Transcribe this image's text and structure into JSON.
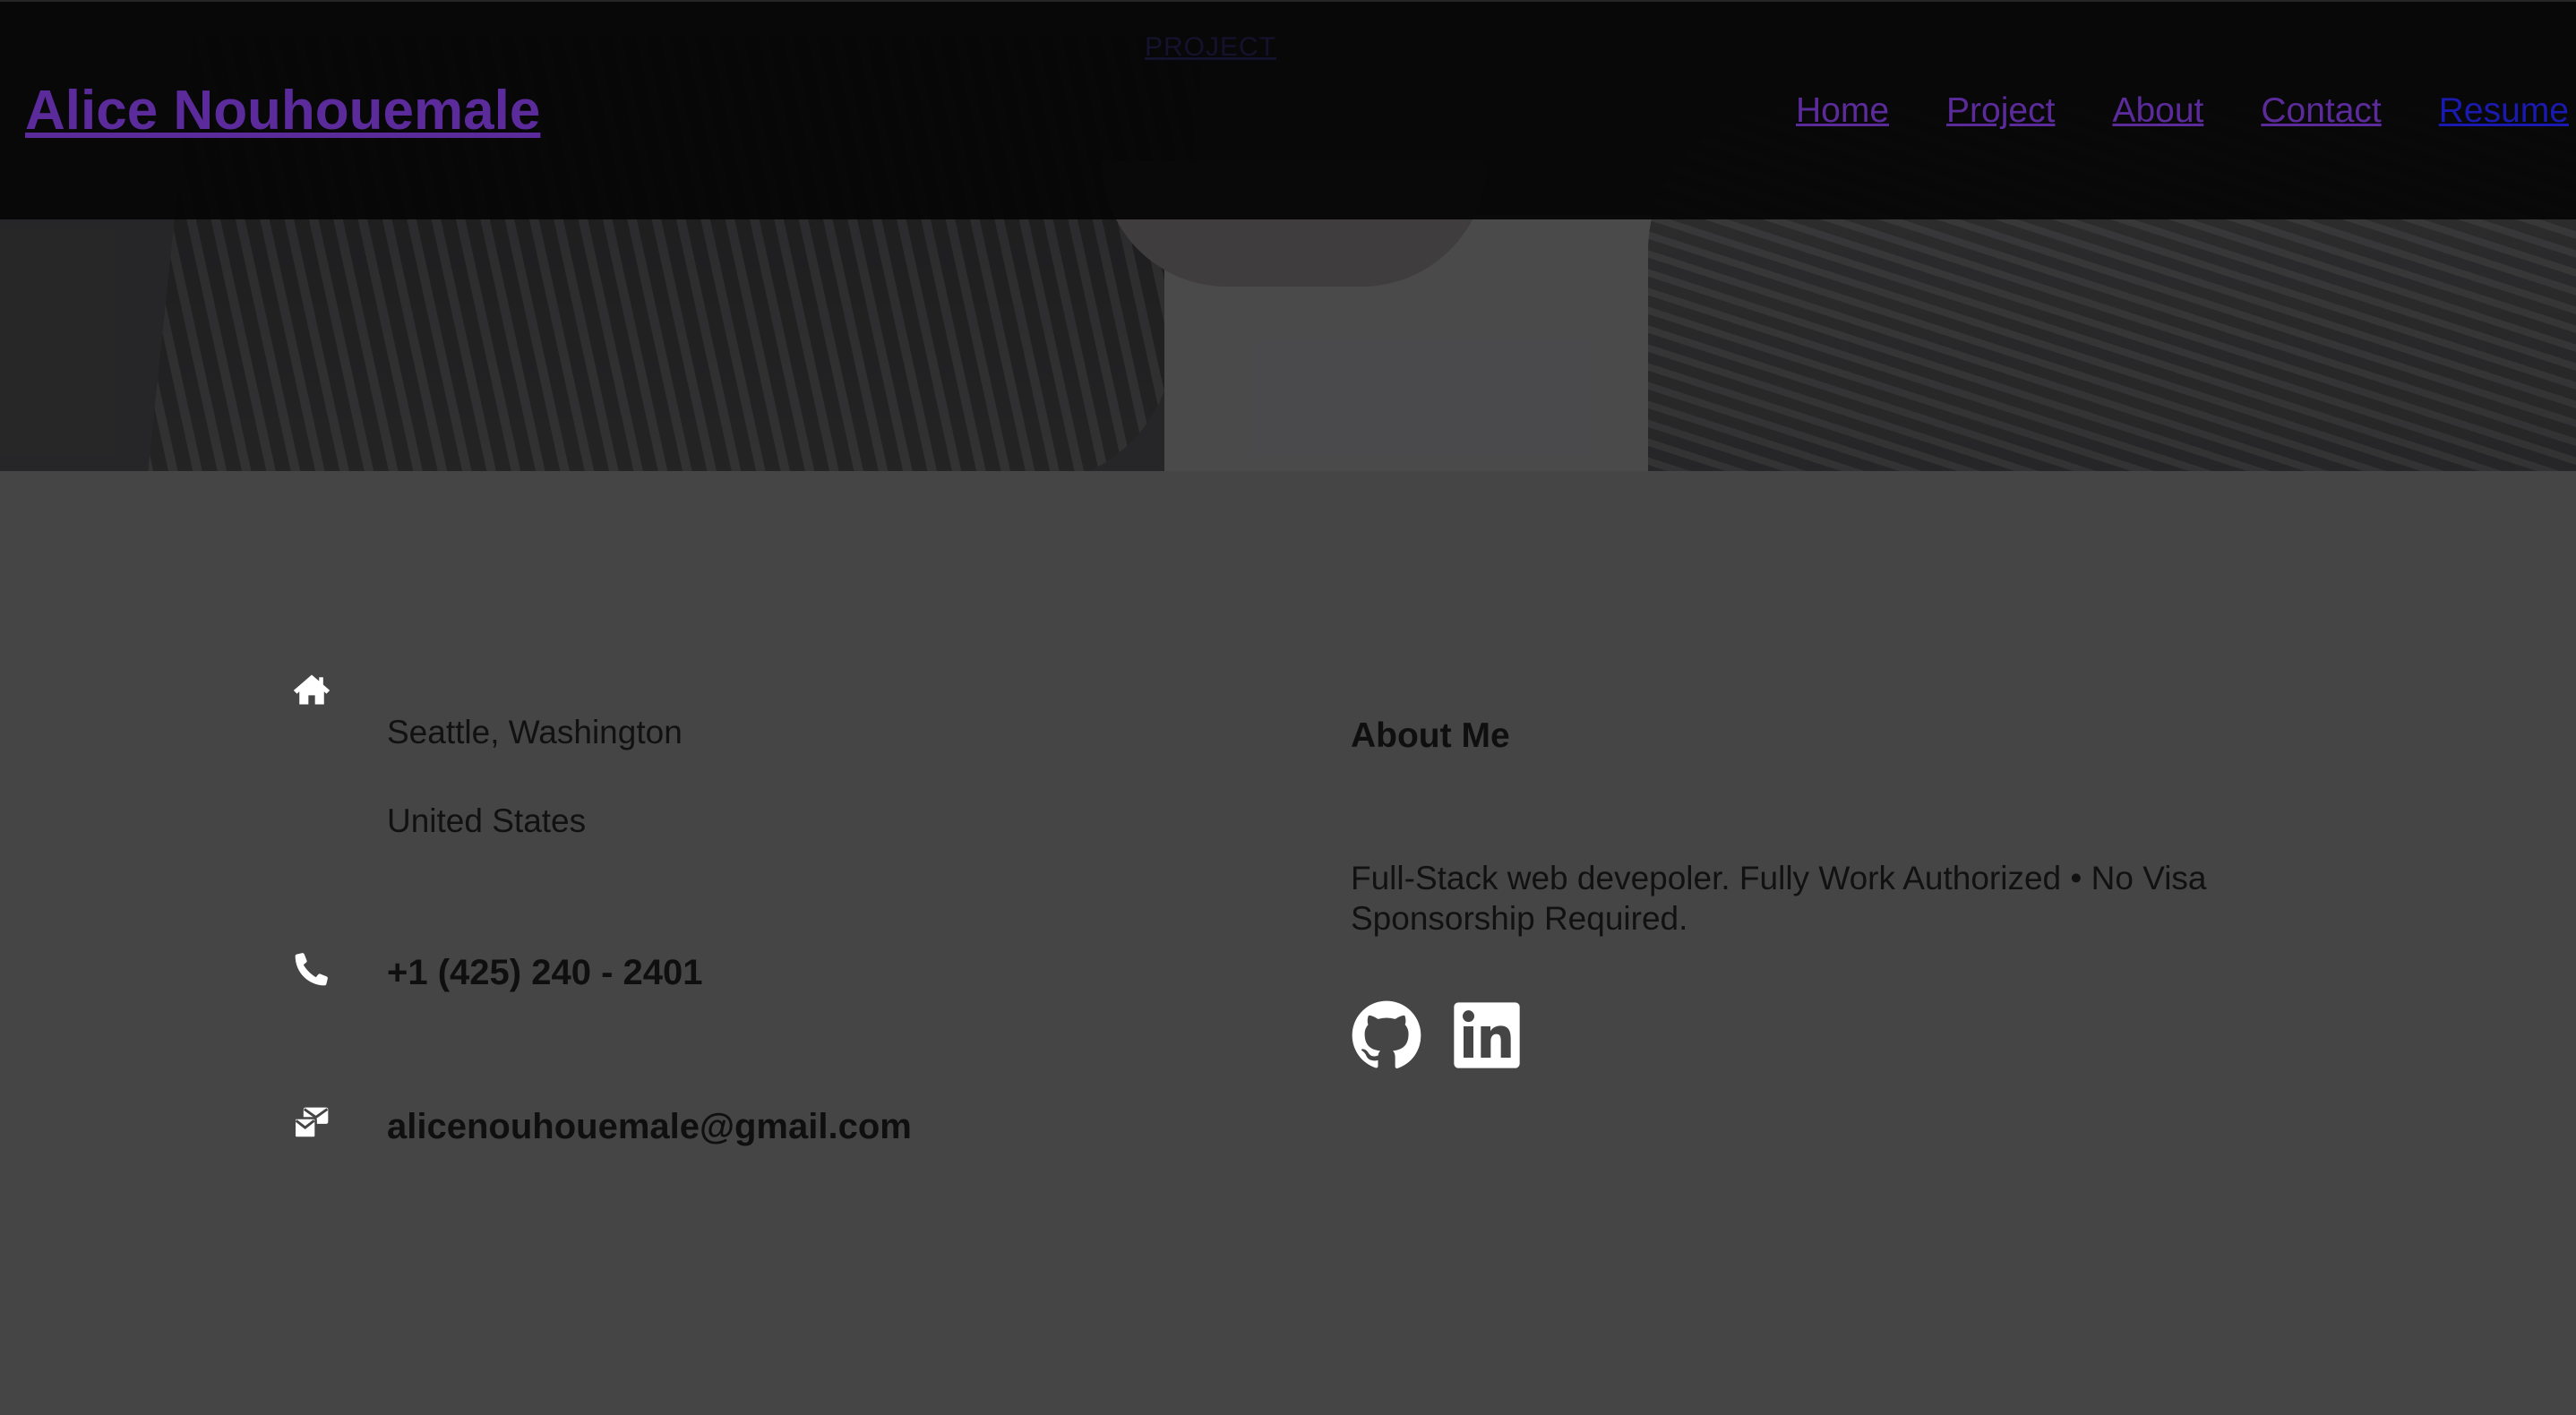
{
  "header": {
    "brand": "Alice Nouhouemale",
    "hidden_link": "PROJECT"
  },
  "nav": {
    "items": [
      "Home",
      "Project",
      "About",
      "Contact",
      "Resume"
    ]
  },
  "contact": {
    "address_line1": "Seattle, Washington",
    "address_line2": "United States",
    "phone": "+1 (425) 240 - 2401",
    "email": "alicenouhouemale@gmail.com"
  },
  "about": {
    "title": "About Me",
    "text": "Full-Stack web devepoler. Fully Work Authorized • No Visa Sponsorship Required."
  },
  "icons": {
    "address": "home-icon",
    "phone": "phone-icon",
    "email": "mail-icon",
    "social": [
      "github-icon",
      "linkedin-icon"
    ]
  },
  "colors": {
    "background": "#454545",
    "navbar": "#060606",
    "link": "#5c2b9b"
  }
}
